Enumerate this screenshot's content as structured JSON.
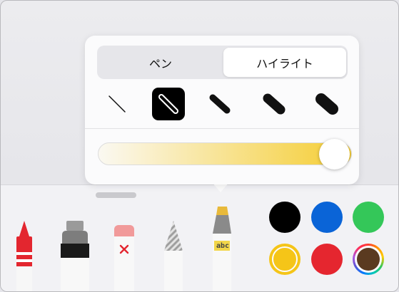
{
  "popover": {
    "tabs": [
      {
        "label": "ペン",
        "selected": false
      },
      {
        "label": "ハイライト",
        "selected": true
      }
    ],
    "stroke_widths": [
      {
        "icon": "thin-line-icon",
        "selected": false
      },
      {
        "icon": "medium-line-icon",
        "selected": true
      },
      {
        "icon": "thick-line-icon",
        "selected": false
      },
      {
        "icon": "thicker-line-icon",
        "selected": false
      },
      {
        "icon": "thickest-line-icon",
        "selected": false
      }
    ],
    "opacity": 1.0,
    "opacity_color": "#f5cd32"
  },
  "tools": [
    {
      "name": "crayon",
      "icon": "crayon-icon"
    },
    {
      "name": "paint",
      "icon": "paint-tube-icon"
    },
    {
      "name": "eraser",
      "icon": "eraser-icon"
    },
    {
      "name": "pencil",
      "icon": "pencil-icon"
    },
    {
      "name": "highlighter",
      "icon": "highlighter-icon",
      "label": "abc",
      "selected": true
    }
  ],
  "colors": [
    {
      "name": "black",
      "hex": "#000000"
    },
    {
      "name": "blue",
      "hex": "#0a64d7"
    },
    {
      "name": "green",
      "hex": "#34c759"
    },
    {
      "name": "yellow",
      "hex": "#f5c518",
      "selected": true
    },
    {
      "name": "red",
      "hex": "#e5262f"
    },
    {
      "name": "custom",
      "hex": "#5a3a20",
      "icon": "color-wheel-icon"
    }
  ]
}
